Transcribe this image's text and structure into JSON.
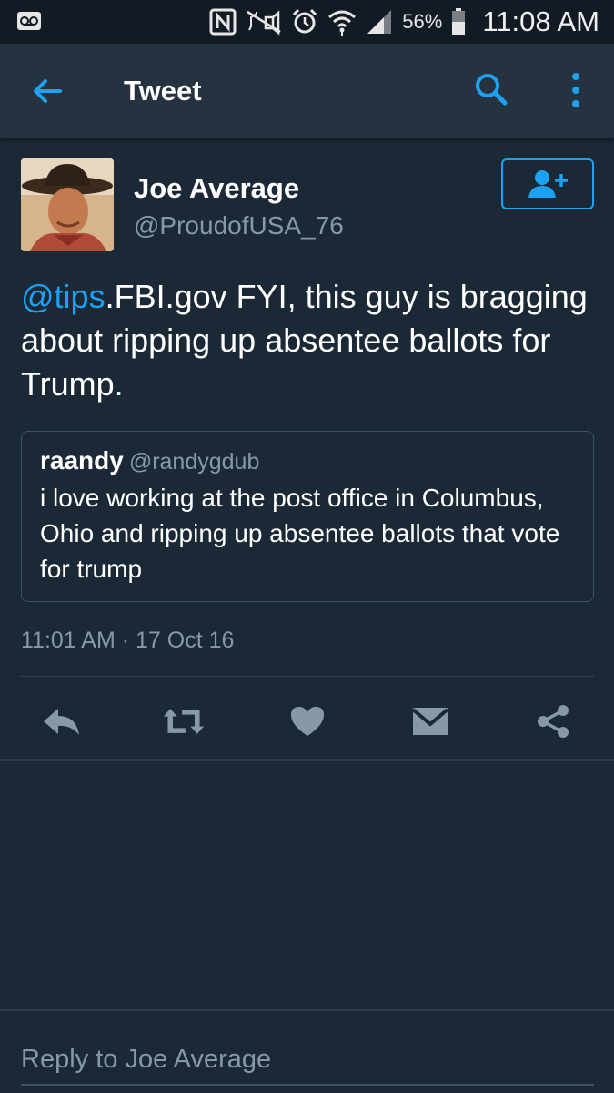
{
  "status_bar": {
    "battery_percent": "56%",
    "time": "11:08 AM",
    "icons": [
      "voicemail-icon",
      "nfc-icon",
      "mute-icon",
      "alarm-icon",
      "wifi-icon",
      "signal-icon",
      "battery-icon"
    ]
  },
  "app_bar": {
    "title": "Tweet",
    "icons": [
      "back-arrow-icon",
      "search-icon",
      "more-vert-icon"
    ]
  },
  "tweet": {
    "author_name": "Joe Average",
    "author_handle": "@ProudofUSA_76",
    "text_mention": "@tips",
    "text_rest": ".FBI.gov FYI, this guy is bragging about ripping up absentee ballots for Trump.",
    "quoted": {
      "name": "raandy",
      "handle": "@randygdub",
      "text": "i love working at the post office in Columbus, Ohio and ripping up absentee ballots that vote for trump"
    },
    "timestamp": "11:01 AM · 17 Oct 16",
    "actions": [
      "reply-icon",
      "retweet-icon",
      "like-icon",
      "direct-message-icon",
      "share-icon"
    ]
  },
  "reply": {
    "placeholder": "Reply to Joe Average"
  },
  "colors": {
    "background": "#1b2836",
    "app_bar": "#253341",
    "accent": "#1da1f2",
    "secondary_text": "#8899a6"
  }
}
